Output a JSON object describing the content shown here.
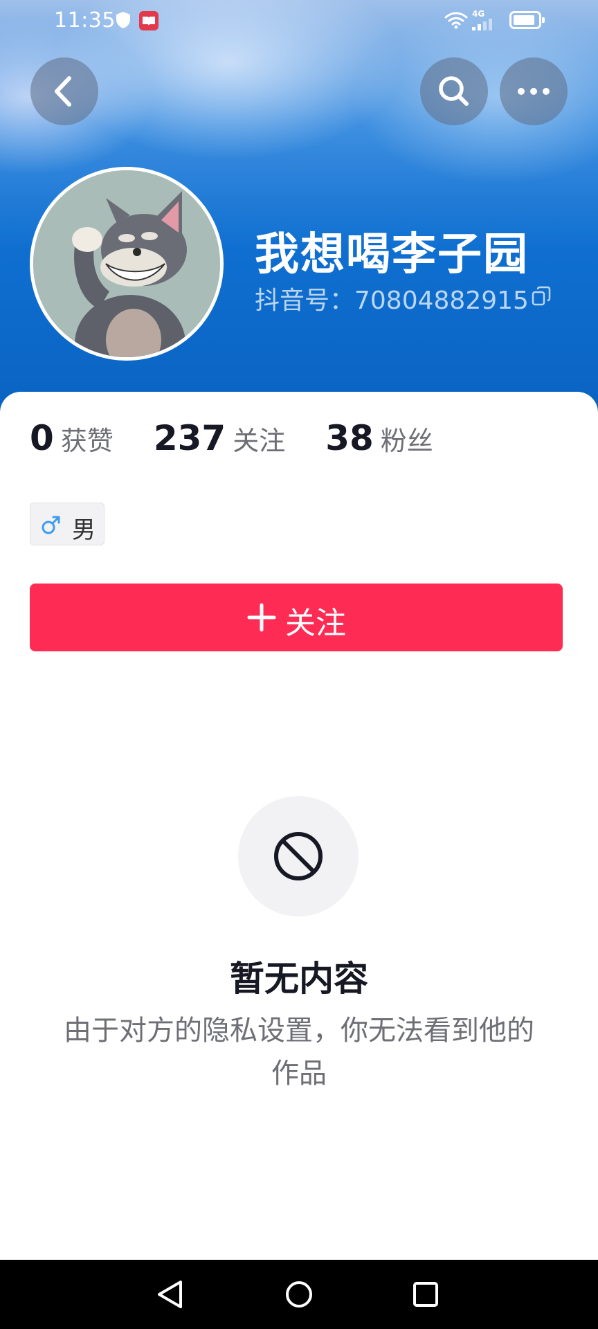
{
  "status_bar": {
    "time": "11:35",
    "network": "4G"
  },
  "header": {
    "back_icon": "chevron-left-icon",
    "search_icon": "search-icon",
    "more_icon": "more-dots-icon"
  },
  "profile": {
    "avatar": "cartoon-cat-avatar",
    "username": "我想喝李子园",
    "douyin_id": "抖音号：70804882915",
    "copy_icon": "copy-icon"
  },
  "stats": [
    {
      "value": "0",
      "label": "获赞"
    },
    {
      "value": "237",
      "label": "关注"
    },
    {
      "value": "38",
      "label": "粉丝"
    }
  ],
  "gender_tag": {
    "icon": "male-icon",
    "label": "男",
    "icon_color": "#3d9bf0"
  },
  "follow_button": {
    "label": "关注",
    "color": "#fe2c55"
  },
  "empty_state": {
    "icon": "blocked-icon",
    "title": "暂无内容",
    "description": "由于对方的隐私设置，你无法看到他的作品"
  },
  "nav_bar": {
    "back": "nav-back-icon",
    "home": "nav-home-icon",
    "recents": "nav-recents-icon"
  }
}
